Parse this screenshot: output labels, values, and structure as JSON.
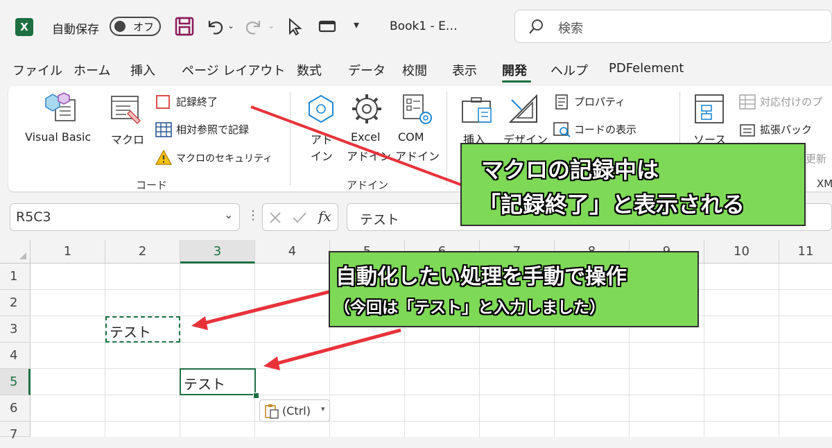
{
  "titlebar": {
    "autosave_label": "自動保存",
    "autosave_state": "オフ",
    "book_name": "Book1  -  E…",
    "search_placeholder": "検索"
  },
  "tabs": [
    "ファイル",
    "ホーム",
    "挿入",
    "ページ レイアウト",
    "数式",
    "データ",
    "校閲",
    "表示",
    "開発",
    "ヘルプ",
    "PDFelement"
  ],
  "active_tab": "開発",
  "ribbon": {
    "code_group": {
      "label": "コード",
      "visual_basic": "Visual Basic",
      "macro": "マクロ",
      "stop_recording": "記録終了",
      "relative_ref": "相対参照で記録",
      "macro_security": "マクロのセキュリティ"
    },
    "addin_group": {
      "label": "アドイン",
      "addin_line1": "アド",
      "addin_line2": "イン",
      "excel_addin_line1": "Excel",
      "excel_addin_line2": "アドイン",
      "com_addin_line1": "COM",
      "com_addin_line2": "アドイン"
    },
    "controls_group": {
      "insert": "挿入",
      "design": "デザイン",
      "properties": "プロパティ",
      "view_code": "コードの表示"
    },
    "xml_group": {
      "source": "ソース",
      "map_properties": "対応付けのプ",
      "expansion_packs": "拡張パック",
      "refresh_partial": "更新",
      "label_partial": "XM"
    }
  },
  "formula_bar": {
    "name_box": "R5C3",
    "fx": "fx",
    "value": "テスト"
  },
  "grid": {
    "columns": [
      "1",
      "2",
      "3",
      "4",
      "5",
      "6",
      "7",
      "8",
      "9",
      "10",
      "11"
    ],
    "rows": [
      "1",
      "2",
      "3",
      "4",
      "5",
      "6",
      "7"
    ],
    "selected_col": "3",
    "selected_row": "5",
    "cell_r3c2": "テスト",
    "cell_r5c3": "テスト",
    "paste_options": "(Ctrl)"
  },
  "callouts": {
    "top_line1": "マクロの記録中は",
    "top_line2": "「記録終了」と表示される",
    "mid_line1": "自動化したい処理を手動で操作",
    "mid_line2": "（今回は「テスト」と入力しました）"
  },
  "colors": {
    "excel_green": "#1d6f42",
    "callout_green": "#7ed957",
    "arrow_red": "#e8323a",
    "stop_record_red": "#d83b3b"
  }
}
